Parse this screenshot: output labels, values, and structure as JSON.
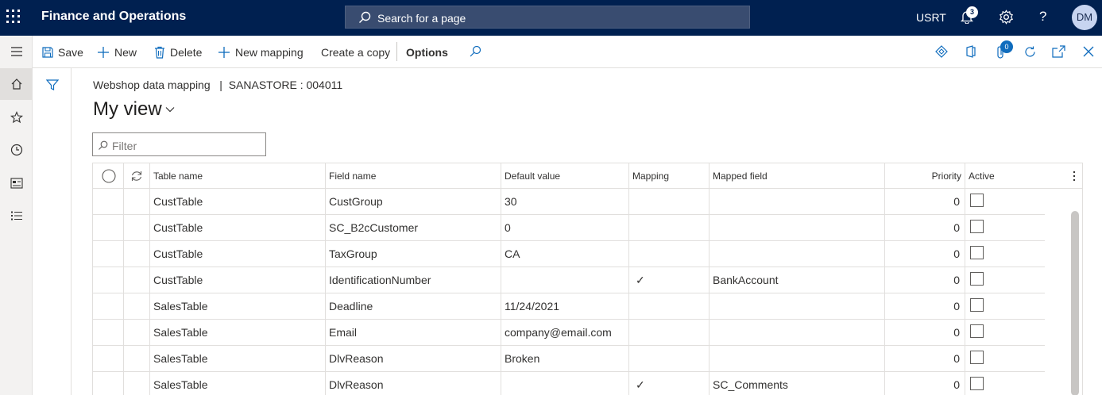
{
  "header": {
    "app_title": "Finance and Operations",
    "search_placeholder": "Search for a page",
    "company": "USRT",
    "notification_count": "3",
    "help_glyph": "?",
    "user_initials": "DM"
  },
  "toolbar": {
    "save": "Save",
    "new": "New",
    "delete": "Delete",
    "new_mapping": "New mapping",
    "create_copy": "Create a copy",
    "options": "Options",
    "attachments_count": "0"
  },
  "page": {
    "breadcrumb": "Webshop data mapping",
    "breadcrumb_sep": "|",
    "record": "SANASTORE : 004011",
    "view_name": "My view",
    "filter_placeholder": "Filter"
  },
  "grid": {
    "columns": {
      "table_name": "Table name",
      "field_name": "Field name",
      "default_value": "Default value",
      "mapping": "Mapping",
      "mapped_field": "Mapped field",
      "priority": "Priority",
      "active": "Active"
    },
    "rows": [
      {
        "table": "CustTable",
        "field": "CustGroup",
        "default": "30",
        "mapping": "",
        "mapped": "",
        "priority": "0",
        "active": false
      },
      {
        "table": "CustTable",
        "field": "SC_B2cCustomer",
        "default": "0",
        "mapping": "",
        "mapped": "",
        "priority": "0",
        "active": false
      },
      {
        "table": "CustTable",
        "field": "TaxGroup",
        "default": "CA",
        "mapping": "",
        "mapped": "",
        "priority": "0",
        "active": false
      },
      {
        "table": "CustTable",
        "field": "IdentificationNumber",
        "default": "",
        "mapping": "✓",
        "mapped": "BankAccount",
        "priority": "0",
        "active": false
      },
      {
        "table": "SalesTable",
        "field": "Deadline",
        "default": "11/24/2021",
        "mapping": "",
        "mapped": "",
        "priority": "0",
        "active": false
      },
      {
        "table": "SalesTable",
        "field": "Email",
        "default": "company@email.com",
        "mapping": "",
        "mapped": "",
        "priority": "0",
        "active": false
      },
      {
        "table": "SalesTable",
        "field": "DlvReason",
        "default": "Broken",
        "mapping": "",
        "mapped": "",
        "priority": "0",
        "active": false
      },
      {
        "table": "SalesTable",
        "field": "DlvReason",
        "default": "",
        "mapping": "✓",
        "mapped": "SC_Comments",
        "priority": "0",
        "active": false
      }
    ]
  },
  "icons": [
    "waffle-icon",
    "search-icon",
    "bell-icon",
    "gear-icon",
    "help-icon",
    "hamburger-icon",
    "home-icon",
    "star-icon",
    "clock-icon",
    "workspace-icon",
    "list-icon",
    "save-icon",
    "add-icon",
    "trash-icon",
    "filter-icon",
    "refresh-icon",
    "diamond-icon",
    "office-icon",
    "paperclip-icon",
    "open-new-icon",
    "close-icon",
    "more-icon"
  ],
  "colors": {
    "topbar": "#002050",
    "accent": "#0f6cbd"
  }
}
